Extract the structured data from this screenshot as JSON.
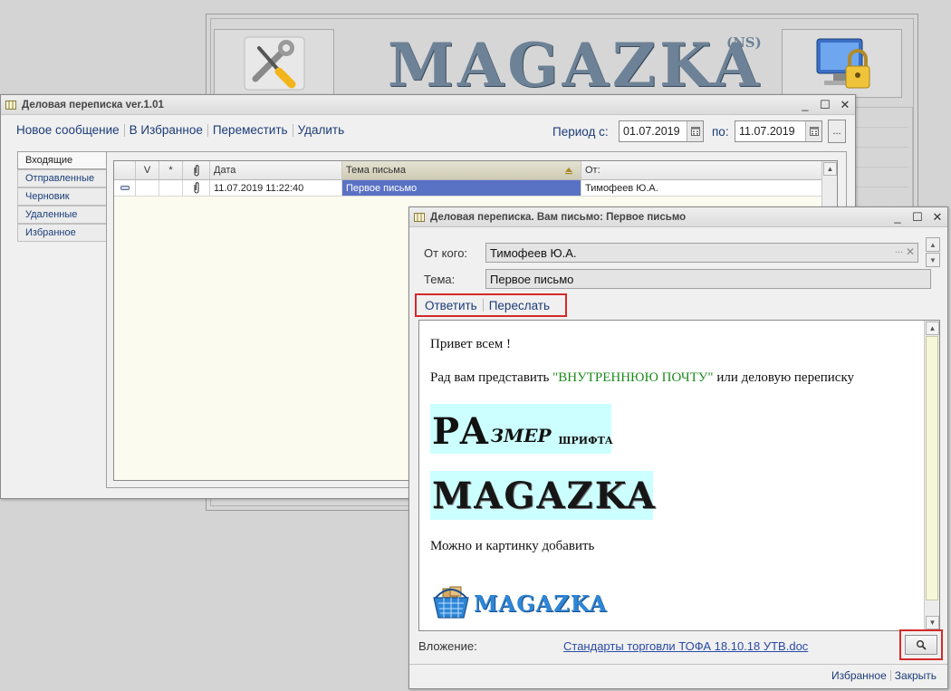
{
  "background_app": {
    "logo": "MAGAZKA",
    "logo_sup": "(NS)",
    "tools_icon": "tools-icon",
    "security_icon": "computer-lock-icon"
  },
  "main_window": {
    "title": "Деловая переписка ver.1.01",
    "toolbar": [
      "Новое сообщение",
      "В Избранное",
      "Переместить",
      "Удалить"
    ],
    "period_from_label": "Период с:",
    "period_from": "01.07.2019",
    "period_to_label": "по:",
    "period_to": "11.07.2019",
    "period_more": "...",
    "folders": [
      "Входящие",
      "Отправленные",
      "Черновик",
      "Удаленные",
      "Избранное"
    ],
    "active_folder": 0,
    "columns": {
      "read": "V",
      "star": "*",
      "attach_icon": "paperclip-icon",
      "date": "Дата",
      "subject": "Тема письма",
      "from": "От:"
    },
    "rows": [
      {
        "date": "11.07.2019 11:22:40",
        "subject": "Первое письмо",
        "from": "Тимофеев Ю.А."
      }
    ]
  },
  "letter_window": {
    "title": "Деловая переписка. Вам письмо: Первое письмо",
    "from_label": "От кого:",
    "from_value": "Тимофеев Ю.А.",
    "subject_label": "Тема:",
    "subject_value": "Первое письмо",
    "actions": [
      "Ответить",
      "Переслать"
    ],
    "body": {
      "greeting": "Привет всем !",
      "intro_before": "Рад вам представить ",
      "intro_highlight": "\"ВНУТРЕННЮЮ ПОЧТУ\"",
      "intro_after": " или деловую переписку",
      "size_big": "РА",
      "size_mid": "змер",
      "size_small": "шрифта",
      "brand": "MAGAZKA",
      "picture_note": "Можно и картинку добавить",
      "logo_text": "MAGAZKA"
    },
    "attachment_label": "Вложение:",
    "attachment_file": "Стандарты торговли ТОФА  18.10.18  УТВ.doc",
    "footer_links": [
      "Избранное",
      "Закрыть"
    ]
  },
  "colors": {
    "selection": "#5a72c4",
    "link": "#1c3c78",
    "highlight_box": "#d42a2a",
    "cyan_bg": "#ccffff",
    "green_text": "#1e8a1e"
  }
}
